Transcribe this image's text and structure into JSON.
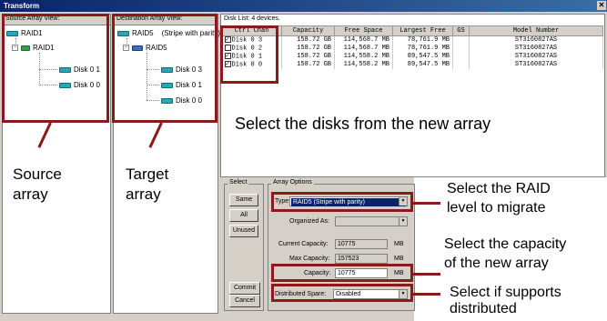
{
  "window": {
    "title": "Transform"
  },
  "source_pane": {
    "header": "Source Array View:",
    "root": "RAID1",
    "array": "RAID1",
    "disks": [
      "Disk  0 1",
      "Disk  0 0"
    ]
  },
  "target_pane": {
    "header": "Destination Array View:",
    "root": "RAID5",
    "root_note": "(Stripe with parity)",
    "array": "RAID5",
    "disks": [
      "Disk  0 3",
      "Disk  0 1",
      "Disk  0 0"
    ]
  },
  "disk_list": {
    "header": "Disk List: 4 devices.",
    "columns": [
      "Ctrl Chan",
      "Capacity",
      "Free Space",
      "Largest Free",
      "GS",
      "Model Number"
    ],
    "rows": [
      {
        "checked": true,
        "ctrl": "Disk  0 3",
        "capacity": "158.72 GB",
        "free": "114,568.7 MB",
        "largest": "78,761.9 MB",
        "gs": "",
        "model": "ST3160827AS"
      },
      {
        "checked": false,
        "ctrl": "Disk  0 2",
        "capacity": "158.72 GB",
        "free": "114,568.7 MB",
        "largest": "78,761.9 MB",
        "gs": "",
        "model": "ST3160827AS"
      },
      {
        "checked": true,
        "ctrl": "Disk  0 1",
        "capacity": "158.72 GB",
        "free": "114,558.2 MB",
        "largest": "89,547.5 MB",
        "gs": "",
        "model": "ST3160827AS"
      },
      {
        "checked": true,
        "ctrl": "Disk  0 0",
        "capacity": "158.72 GB",
        "free": "114,558.2 MB",
        "largest": "89,547.5 MB",
        "gs": "",
        "model": "ST3160827AS"
      }
    ]
  },
  "select_group": {
    "label": "Select",
    "buttons": [
      "Same",
      "All",
      "Unused"
    ]
  },
  "array_options": {
    "label": "Array Options",
    "type_label": "Type:",
    "type_value": "RAID5    (Stripe with parity)",
    "organized_label": "Organized As:",
    "organized_value": "",
    "current_capacity_label": "Current Capacity:",
    "current_capacity_value": "10775",
    "max_capacity_label": "Max Capacity:",
    "max_capacity_value": "157523",
    "capacity_label": "Capacity:",
    "capacity_value": "10775",
    "unit": "MB",
    "distributed_spare_label": "Distributed Spare:",
    "distributed_spare_value": "Disabled"
  },
  "actions": {
    "commit": "Commit",
    "cancel": "Cancel"
  },
  "annotations": {
    "select_disks": "Select the disks from the new array",
    "source_array": "Source\narray",
    "target_array": "Target\narray",
    "raid_level": "Select the RAID\nlevel to migrate",
    "capacity": "Select the capacity\nof the new array",
    "distributed": "Select if supports\ndistributed"
  },
  "colors": {
    "annotation_red": "#8b1a1a",
    "title_bar": "#0a246a"
  }
}
